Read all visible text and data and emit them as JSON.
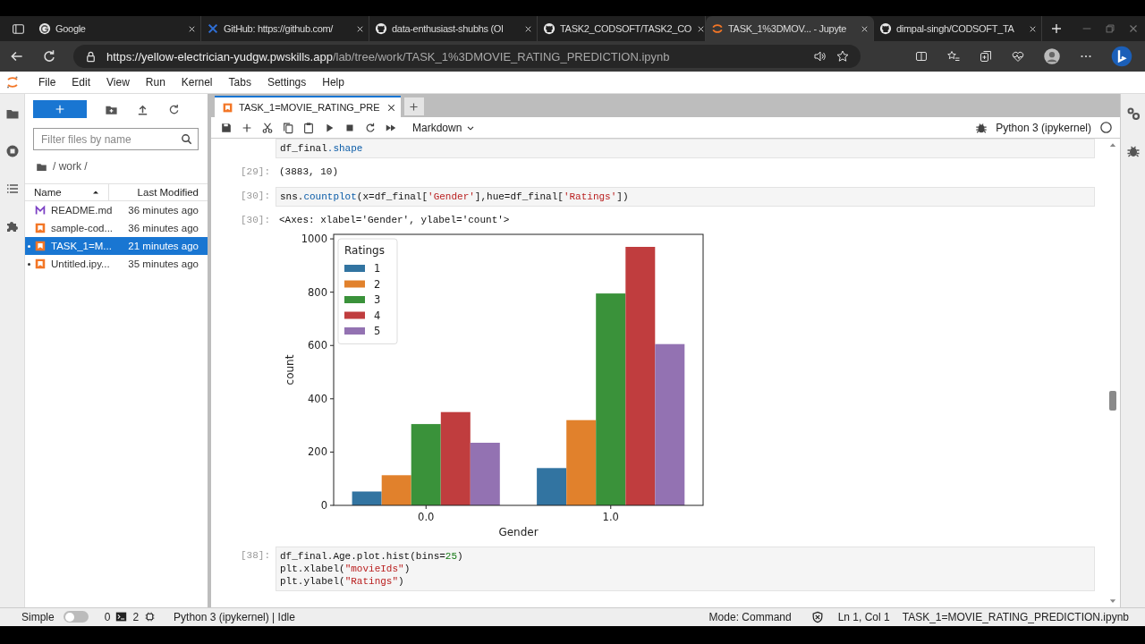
{
  "browser": {
    "tabs": [
      {
        "title": "Google",
        "kind": "google",
        "selected": false
      },
      {
        "title": "GitHub: https://github.com/",
        "kind": "generic",
        "selected": false
      },
      {
        "title": "data-enthusiast-shubhs (Ol",
        "kind": "github",
        "selected": false
      },
      {
        "title": "TASK2_CODSOFT/TASK2_CO",
        "kind": "github",
        "selected": false
      },
      {
        "title": "TASK_1%3DMOV... - Jupyte",
        "kind": "jupyter",
        "selected": true
      },
      {
        "title": "dimpal-singh/CODSOFT_TA",
        "kind": "github",
        "selected": false
      }
    ],
    "url": {
      "host": "https://yellow-electrician-yudgw.pwskills.app",
      "path": "/lab/tree/work/TASK_1%3DMOVIE_RATING_PREDICTION.ipynb"
    }
  },
  "menu": [
    "File",
    "Edit",
    "View",
    "Run",
    "Kernel",
    "Tabs",
    "Settings",
    "Help"
  ],
  "file_browser": {
    "filter_placeholder": "Filter files by name",
    "path": "/ work /",
    "columns": [
      "Name",
      "Last Modified"
    ],
    "files": [
      {
        "name": "README.md",
        "modified": "36 minutes ago",
        "kind": "markdown",
        "selected": false,
        "running": false
      },
      {
        "name": "sample-cod...",
        "modified": "36 minutes ago",
        "kind": "notebook",
        "selected": false,
        "running": false
      },
      {
        "name": "TASK_1=M...",
        "modified": "21 minutes ago",
        "kind": "notebook",
        "selected": true,
        "running": true
      },
      {
        "name": "Untitled.ipy...",
        "modified": "35 minutes ago",
        "kind": "notebook",
        "selected": false,
        "running": true
      }
    ]
  },
  "notebook": {
    "tab": {
      "title": "TASK_1=MOVIE_RATING_PRE",
      "selected": true
    },
    "cell_type": "Markdown",
    "kernel": "Python 3 (ipykernel)",
    "cells": [
      {
        "kind": "code",
        "source": [
          [
            {
              "text": "df_final",
              "kind": "plain"
            },
            {
              "text": ".shape",
              "kind": "property"
            }
          ]
        ]
      },
      {
        "kind": "output",
        "prompt": "[29]:",
        "text": "(3883, 10)"
      },
      {
        "kind": "code",
        "prompt": "[30]:",
        "source": [
          [
            {
              "text": "sns.",
              "kind": "plain"
            },
            {
              "text": "countplot",
              "kind": "property"
            },
            {
              "text": "(x=df_final[",
              "kind": "plain"
            },
            {
              "text": "'Gender'",
              "kind": "string"
            },
            {
              "text": "],hue=df_final[",
              "kind": "plain"
            },
            {
              "text": "'Ratings'",
              "kind": "string"
            },
            {
              "text": "])",
              "kind": "plain"
            }
          ]
        ]
      },
      {
        "kind": "output",
        "prompt": "[30]:",
        "text": "<Axes: xlabel='Gender', ylabel='count'>"
      },
      {
        "kind": "chart",
        "chart_data": {
          "type": "bar",
          "xlabel": "Gender",
          "ylabel": "count",
          "legend": {
            "title": "Ratings"
          },
          "categories": [
            "0.0",
            "1.0"
          ],
          "series": [
            {
              "name": "1",
              "color": "#3274a1",
              "values": [
                52,
                140
              ]
            },
            {
              "name": "2",
              "color": "#e1812c",
              "values": [
                113,
                320
              ]
            },
            {
              "name": "3",
              "color": "#3a923a",
              "values": [
                305,
                795
              ]
            },
            {
              "name": "4",
              "color": "#c03d3e",
              "values": [
                350,
                970
              ]
            },
            {
              "name": "5",
              "color": "#9372b2",
              "values": [
                235,
                605
              ]
            }
          ],
          "ylim": [
            0,
            1017
          ],
          "yticks": [
            0,
            200,
            400,
            600,
            800,
            1000
          ]
        }
      },
      {
        "kind": "code",
        "prompt": "[38]:",
        "source": [
          [
            {
              "text": "df_final.Age.plot.hist(bins=",
              "kind": "plain"
            },
            {
              "text": "25",
              "kind": "number"
            },
            {
              "text": ")",
              "kind": "plain"
            }
          ],
          [
            {
              "text": "plt.xlabel(",
              "kind": "plain"
            },
            {
              "text": "\"movieIds\"",
              "kind": "string"
            },
            {
              "text": ")",
              "kind": "plain"
            }
          ],
          [
            {
              "text": "plt.ylabel(",
              "kind": "plain"
            },
            {
              "text": "\"Ratings\"",
              "kind": "string"
            },
            {
              "text": ")",
              "kind": "plain"
            }
          ]
        ]
      }
    ]
  },
  "status_bar": {
    "mode_label": "Simple",
    "simple_on": false,
    "terminals": "0",
    "kernels": "2",
    "kernel_status": "Python 3 (ipykernel) | Idle",
    "mode": "Mode: Command",
    "position": "Ln 1, Col 1",
    "file": "TASK_1=MOVIE_RATING_PREDICTION.ipynb"
  }
}
